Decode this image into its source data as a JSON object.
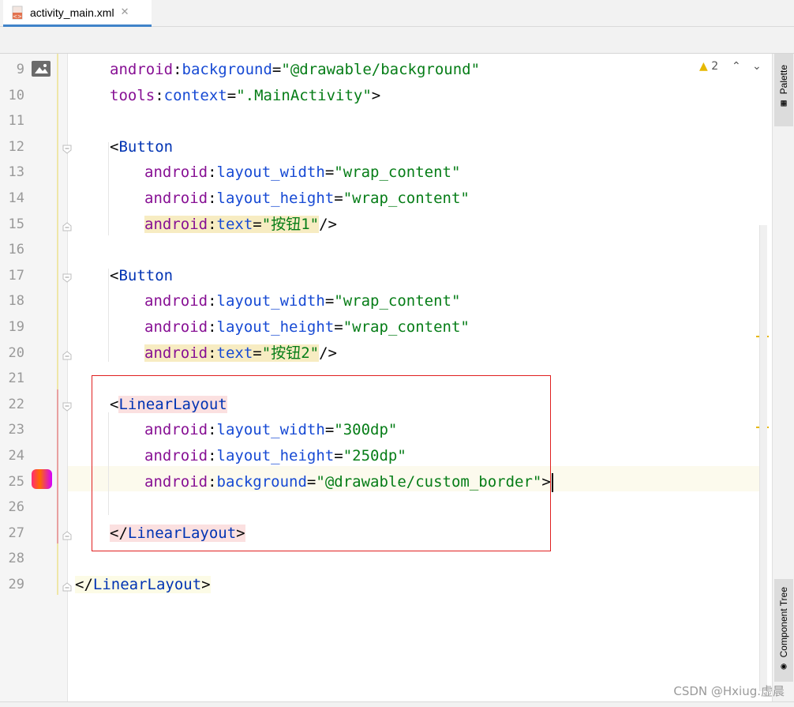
{
  "tab": {
    "title": "activity_main.xml",
    "close": "✕"
  },
  "inspections": {
    "warning_count": "2",
    "warning_icon": "warning-triangle-icon"
  },
  "side_panels": {
    "palette": "Palette",
    "component_tree": "Component Tree"
  },
  "watermark": "CSDN @Hxiug.虚晨",
  "colors": {
    "tab_accent": "#4083c9",
    "selection_box": "#e02020",
    "warning": "#e6b800"
  },
  "lines": [
    {
      "n": "9",
      "parts": [
        [
          "attr-ns",
          "android"
        ],
        [
          "punct",
          ":"
        ],
        [
          "attr",
          "background"
        ],
        [
          "punct",
          "="
        ],
        [
          "val",
          "\"@drawable/background\""
        ]
      ]
    },
    {
      "n": "10",
      "parts": [
        [
          "attr-ns",
          "tools"
        ],
        [
          "punct",
          ":"
        ],
        [
          "attr",
          "context"
        ],
        [
          "punct",
          "="
        ],
        [
          "val",
          "\".MainActivity\""
        ],
        [
          "punct",
          ">"
        ]
      ]
    },
    {
      "n": "11",
      "parts": []
    },
    {
      "n": "12",
      "parts": [
        [
          "punct",
          "<"
        ],
        [
          "tag",
          "Button"
        ]
      ]
    },
    {
      "n": "13",
      "parts": [
        [
          "attr-ns",
          "android"
        ],
        [
          "punct",
          ":"
        ],
        [
          "attr",
          "layout_width"
        ],
        [
          "punct",
          "="
        ],
        [
          "val",
          "\"wrap_content\""
        ]
      ]
    },
    {
      "n": "14",
      "parts": [
        [
          "attr-ns",
          "android"
        ],
        [
          "punct",
          ":"
        ],
        [
          "attr",
          "layout_height"
        ],
        [
          "punct",
          "="
        ],
        [
          "val",
          "\"wrap_content\""
        ]
      ]
    },
    {
      "n": "15",
      "parts": [
        [
          "attr-ns",
          "android"
        ],
        [
          "punct",
          ":"
        ],
        [
          "attr",
          "text"
        ],
        [
          "punct",
          "="
        ],
        [
          "val",
          "\"按钮1\""
        ],
        [
          "punct",
          "/>"
        ]
      ]
    },
    {
      "n": "16",
      "parts": []
    },
    {
      "n": "17",
      "parts": [
        [
          "punct",
          "<"
        ],
        [
          "tag",
          "Button"
        ]
      ]
    },
    {
      "n": "18",
      "parts": [
        [
          "attr-ns",
          "android"
        ],
        [
          "punct",
          ":"
        ],
        [
          "attr",
          "layout_width"
        ],
        [
          "punct",
          "="
        ],
        [
          "val",
          "\"wrap_content\""
        ]
      ]
    },
    {
      "n": "19",
      "parts": [
        [
          "attr-ns",
          "android"
        ],
        [
          "punct",
          ":"
        ],
        [
          "attr",
          "layout_height"
        ],
        [
          "punct",
          "="
        ],
        [
          "val",
          "\"wrap_content\""
        ]
      ]
    },
    {
      "n": "20",
      "parts": [
        [
          "attr-ns",
          "android"
        ],
        [
          "punct",
          ":"
        ],
        [
          "attr",
          "text"
        ],
        [
          "punct",
          "="
        ],
        [
          "val",
          "\"按钮2\""
        ],
        [
          "punct",
          "/>"
        ]
      ]
    },
    {
      "n": "21",
      "parts": []
    },
    {
      "n": "22",
      "parts": [
        [
          "punct",
          "<"
        ],
        [
          "tag",
          "LinearLayout"
        ]
      ]
    },
    {
      "n": "23",
      "parts": [
        [
          "attr-ns",
          "android"
        ],
        [
          "punct",
          ":"
        ],
        [
          "attr",
          "layout_width"
        ],
        [
          "punct",
          "="
        ],
        [
          "val",
          "\"300dp\""
        ]
      ]
    },
    {
      "n": "24",
      "parts": [
        [
          "attr-ns",
          "android"
        ],
        [
          "punct",
          ":"
        ],
        [
          "attr",
          "layout_height"
        ],
        [
          "punct",
          "="
        ],
        [
          "val",
          "\"250dp\""
        ]
      ]
    },
    {
      "n": "25",
      "parts": [
        [
          "attr-ns",
          "android"
        ],
        [
          "punct",
          ":"
        ],
        [
          "attr",
          "background"
        ],
        [
          "punct",
          "="
        ],
        [
          "val",
          "\"@drawable/custom_border\""
        ],
        [
          "punct",
          ">"
        ]
      ]
    },
    {
      "n": "26",
      "parts": []
    },
    {
      "n": "27",
      "parts": [
        [
          "punct",
          "</"
        ],
        [
          "tag",
          "LinearLayout"
        ],
        [
          "punct",
          ">"
        ]
      ]
    },
    {
      "n": "28",
      "parts": []
    },
    {
      "n": "29",
      "parts": [
        [
          "punct",
          "</"
        ],
        [
          "tag",
          "LinearLayout"
        ],
        [
          "punct",
          ">"
        ]
      ]
    }
  ]
}
